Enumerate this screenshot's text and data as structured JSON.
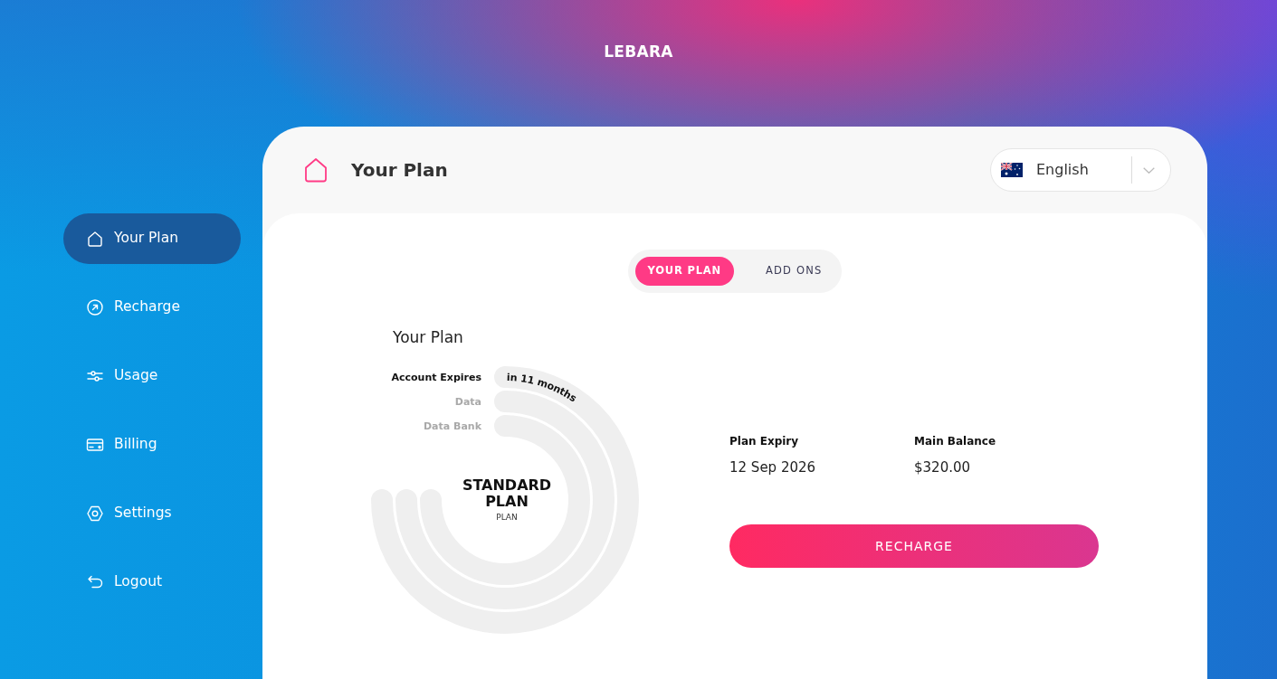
{
  "logo": "LEBARA",
  "sidebar": {
    "items": [
      {
        "label": "Your Plan",
        "selected": true
      },
      {
        "label": "Recharge",
        "selected": false
      },
      {
        "label": "Usage",
        "selected": false
      },
      {
        "label": "Billing",
        "selected": false
      },
      {
        "label": "Settings",
        "selected": false
      },
      {
        "label": "Logout",
        "selected": false
      }
    ]
  },
  "header": {
    "title": "Your Plan",
    "language_select": {
      "value": "English"
    }
  },
  "tabs": [
    {
      "label": "YOUR PLAN",
      "selected": true
    },
    {
      "label": "ADD ONS",
      "selected": false
    }
  ],
  "plan": {
    "heading": "Your Plan",
    "rings": [
      {
        "label": "Account Expires",
        "disabled": false,
        "reading": "in 11 months"
      },
      {
        "label": "Data",
        "disabled": true
      },
      {
        "label": "Data Bank",
        "disabled": true
      }
    ],
    "center": {
      "title": "STANDARD PLAN",
      "subtitle": "PLAN"
    },
    "details": [
      {
        "label": "Plan Expiry",
        "value": "12 Sep 2026"
      },
      {
        "label": "Main Balance",
        "value": "$320.00"
      }
    ],
    "recharge_button": "RECHARGE"
  }
}
